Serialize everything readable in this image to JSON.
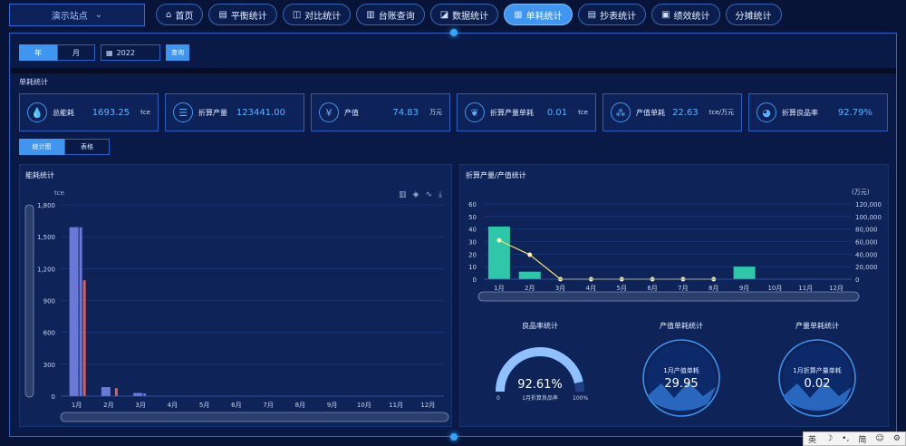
{
  "site_select": {
    "label": "演示站点",
    "icon": "chevron-down-icon"
  },
  "nav": [
    {
      "label": "首页",
      "icon": "home-icon",
      "active": false
    },
    {
      "label": "平衡统计",
      "icon": "balance-icon",
      "active": false
    },
    {
      "label": "对比统计",
      "icon": "compare-icon",
      "active": false
    },
    {
      "label": "台账查询",
      "icon": "ledger-icon",
      "active": false
    },
    {
      "label": "数据统计",
      "icon": "data-icon",
      "active": false
    },
    {
      "label": "单耗统计",
      "icon": "unit-consumption-icon",
      "active": true
    },
    {
      "label": "抄表统计",
      "icon": "meter-icon",
      "active": false
    },
    {
      "label": "绩效统计",
      "icon": "performance-icon",
      "active": false
    },
    {
      "label": "分摊统计",
      "icon": "",
      "active": false
    }
  ],
  "filter": {
    "period_options": [
      "年",
      "月"
    ],
    "active_period": "年",
    "date_value": "2022",
    "query_label": "查询"
  },
  "section_title": "单耗统计",
  "cards": [
    {
      "label": "总能耗",
      "value": "1693.25",
      "unit": "tce",
      "icon": "drop-icon"
    },
    {
      "label": "折算产量",
      "value": "123441.00",
      "unit": "",
      "icon": "list-icon"
    },
    {
      "label": "产值",
      "value": "74.83",
      "unit": "万元",
      "icon": "yen-icon"
    },
    {
      "label": "折算产量单耗",
      "value": "0.01",
      "unit": "tce",
      "icon": "leaf-icon"
    },
    {
      "label": "产值单耗",
      "value": "22.63",
      "unit": "tce/万元",
      "icon": "cluster-icon"
    },
    {
      "label": "折算良品率",
      "value": "92.79%",
      "unit": "",
      "icon": "pie-icon"
    }
  ],
  "view_toggle": [
    "统计图",
    "表格"
  ],
  "left_panel": {
    "title": "能耗统计",
    "unit_label": "tce"
  },
  "right_panel": {
    "title": "折算产量/产值统计",
    "unit_label": "(万元)"
  },
  "colors": {
    "accent": "#3e96f0",
    "bar_blue": "#6a78d8",
    "bar_red": "#d8605a",
    "bar_teal": "#2fc7aa",
    "line_yellow": "#f2e06a"
  },
  "chart_data": [
    {
      "type": "bar",
      "title": "能耗统计",
      "ylabel": "tce",
      "categories": [
        "1月",
        "2月",
        "3月",
        "4月",
        "5月",
        "6月",
        "7月",
        "8月",
        "9月",
        "10月",
        "11月",
        "12月"
      ],
      "ylim": [
        0,
        1800
      ],
      "yticks": [
        "0",
        "300",
        "600",
        "900",
        "1,200",
        "1,500",
        "1,800"
      ],
      "series": [
        {
          "values": [
            1590,
            85,
            30,
            0,
            0,
            0,
            0,
            0,
            0,
            0,
            0,
            0
          ]
        },
        {
          "values": [
            1590,
            0,
            25,
            0,
            0,
            0,
            0,
            0,
            0,
            0,
            0,
            0
          ]
        },
        {
          "values": [
            1090,
            75,
            0,
            0,
            0,
            0,
            0,
            0,
            0,
            0,
            0,
            0
          ]
        }
      ]
    },
    {
      "type": "bar",
      "title": "折算产量/产值统计",
      "categories": [
        "1月",
        "2月",
        "3月",
        "4月",
        "5月",
        "6月",
        "7月",
        "8月",
        "9月",
        "10月",
        "11月",
        "12月"
      ],
      "ylim": [
        0,
        60
      ],
      "ylim_right": [
        0,
        120000
      ],
      "yticks_left": [
        "0",
        "10",
        "20",
        "30",
        "40",
        "50",
        "60"
      ],
      "yticks_right": [
        "0",
        "20,000",
        "40,000",
        "60,000",
        "80,000",
        "100,000",
        "120,000"
      ],
      "y2label": "(万元)",
      "series": [
        {
          "type": "bar",
          "axis": "left",
          "values": [
            42,
            6,
            0,
            0,
            0,
            0,
            0,
            0,
            10,
            0,
            0,
            0
          ]
        },
        {
          "type": "line",
          "axis": "right",
          "values": [
            62000,
            39000,
            0,
            0,
            0,
            0,
            0,
            0,
            null,
            null,
            null,
            null
          ]
        }
      ]
    }
  ],
  "gauges": [
    {
      "title": "良品率统计",
      "value": "92.61%",
      "sub": "1月折算良品率",
      "min": "0",
      "max": "100%",
      "fraction": 0.926
    },
    {
      "title": "产值单耗统计",
      "value": "29.95",
      "sub": "1月产值单耗"
    },
    {
      "title": "产量单耗统计",
      "value": "0.02",
      "sub": "1月折算产量单耗"
    }
  ],
  "ime_bar": [
    "英",
    "☽",
    "•,",
    "简",
    "☺",
    "⚙"
  ]
}
